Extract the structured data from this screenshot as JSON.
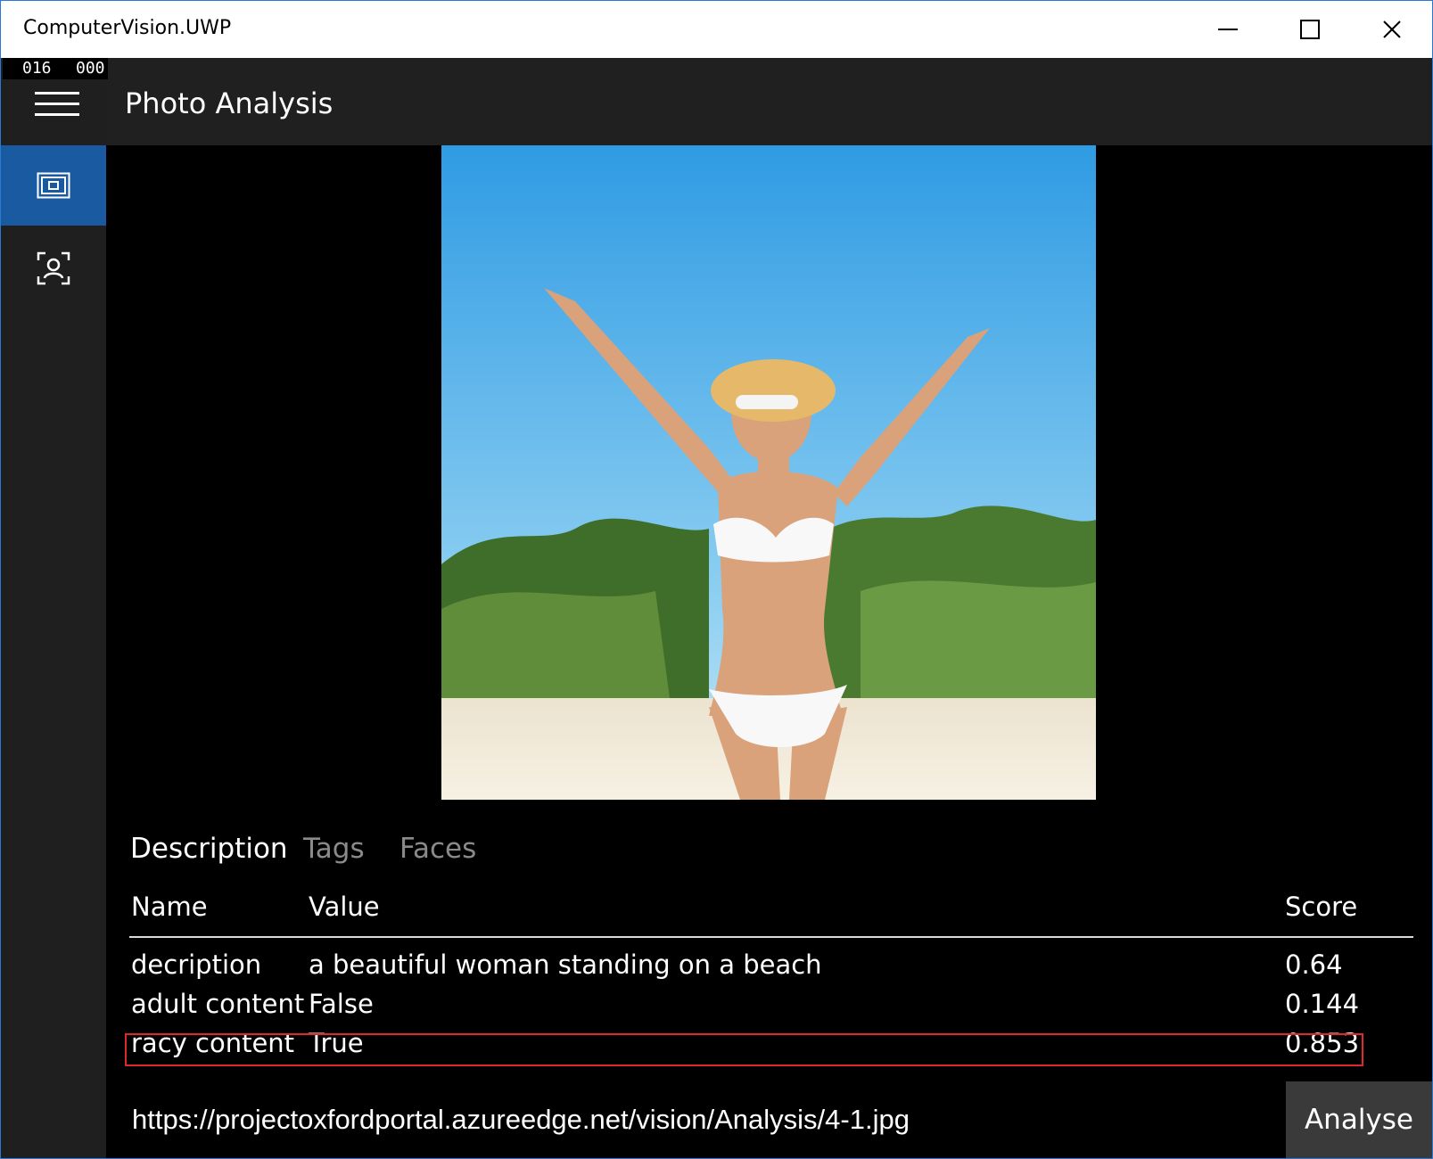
{
  "window": {
    "title": "ComputerVision.UWP"
  },
  "counter": {
    "left": "016",
    "right": "000"
  },
  "header": {
    "title": "Photo Analysis"
  },
  "tabs": [
    {
      "label": "Description"
    },
    {
      "label": "Tags"
    },
    {
      "label": "Faces"
    }
  ],
  "table": {
    "headers": {
      "name": "Name",
      "value": "Value",
      "score": "Score"
    },
    "rows": [
      {
        "name": "decription",
        "value": "a beautiful woman standing on a beach",
        "score": "0.64"
      },
      {
        "name": "adult content",
        "value": "False",
        "score": "0.144"
      },
      {
        "name": "racy content",
        "value": "True",
        "score": "0.853"
      }
    ]
  },
  "url": {
    "value": "https://projectoxfordportal.azureedge.net/vision/Analysis/4-1.jpg"
  },
  "analyse_button": {
    "label": "Analyse"
  },
  "colors": {
    "accent": "#1a5aa0",
    "highlight": "#e0282b",
    "sidebar": "#1f1f1f",
    "header": "#202020"
  }
}
